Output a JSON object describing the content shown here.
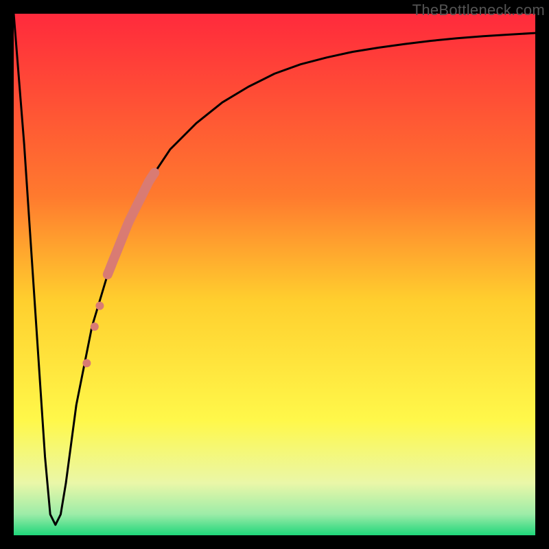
{
  "watermark": "TheBottleneck.com",
  "chart_data": {
    "type": "line",
    "title": "",
    "xlabel": "",
    "ylabel": "",
    "xlim": [
      0,
      100
    ],
    "ylim": [
      0,
      100
    ],
    "grid": false,
    "legend": false,
    "background_gradient": {
      "stops": [
        {
          "offset": 0.0,
          "color": "#ff2a3c"
        },
        {
          "offset": 0.35,
          "color": "#ff7a2e"
        },
        {
          "offset": 0.55,
          "color": "#ffcf2e"
        },
        {
          "offset": 0.78,
          "color": "#fff84a"
        },
        {
          "offset": 0.9,
          "color": "#eaf7a8"
        },
        {
          "offset": 0.96,
          "color": "#9ceca8"
        },
        {
          "offset": 1.0,
          "color": "#1fd67a"
        }
      ]
    },
    "series": [
      {
        "name": "bottleneck-curve",
        "x": [
          0,
          2,
          4,
          6,
          7,
          8,
          9,
          10,
          12,
          15,
          18,
          22,
          26,
          30,
          35,
          40,
          45,
          50,
          55,
          60,
          65,
          70,
          75,
          80,
          85,
          90,
          95,
          100
        ],
        "y": [
          100,
          75,
          45,
          15,
          4,
          2,
          4,
          10,
          25,
          40,
          50,
          60,
          68,
          74,
          79,
          83,
          86,
          88.5,
          90.3,
          91.6,
          92.7,
          93.5,
          94.2,
          94.8,
          95.3,
          95.7,
          96.0,
          96.3
        ]
      }
    ],
    "markers": [
      {
        "name": "heavy-marker-band",
        "type": "stroke",
        "x_range": [
          18,
          27
        ],
        "y_range": [
          48,
          70
        ],
        "color": "#d97b73",
        "width": 14
      },
      {
        "name": "dot-1",
        "x": 16.5,
        "y": 44,
        "r": 6,
        "color": "#d97b73"
      },
      {
        "name": "dot-2",
        "x": 15.5,
        "y": 40,
        "r": 6,
        "color": "#d97b73"
      },
      {
        "name": "dot-3",
        "x": 14.0,
        "y": 33,
        "r": 6,
        "color": "#d97b73"
      }
    ]
  }
}
